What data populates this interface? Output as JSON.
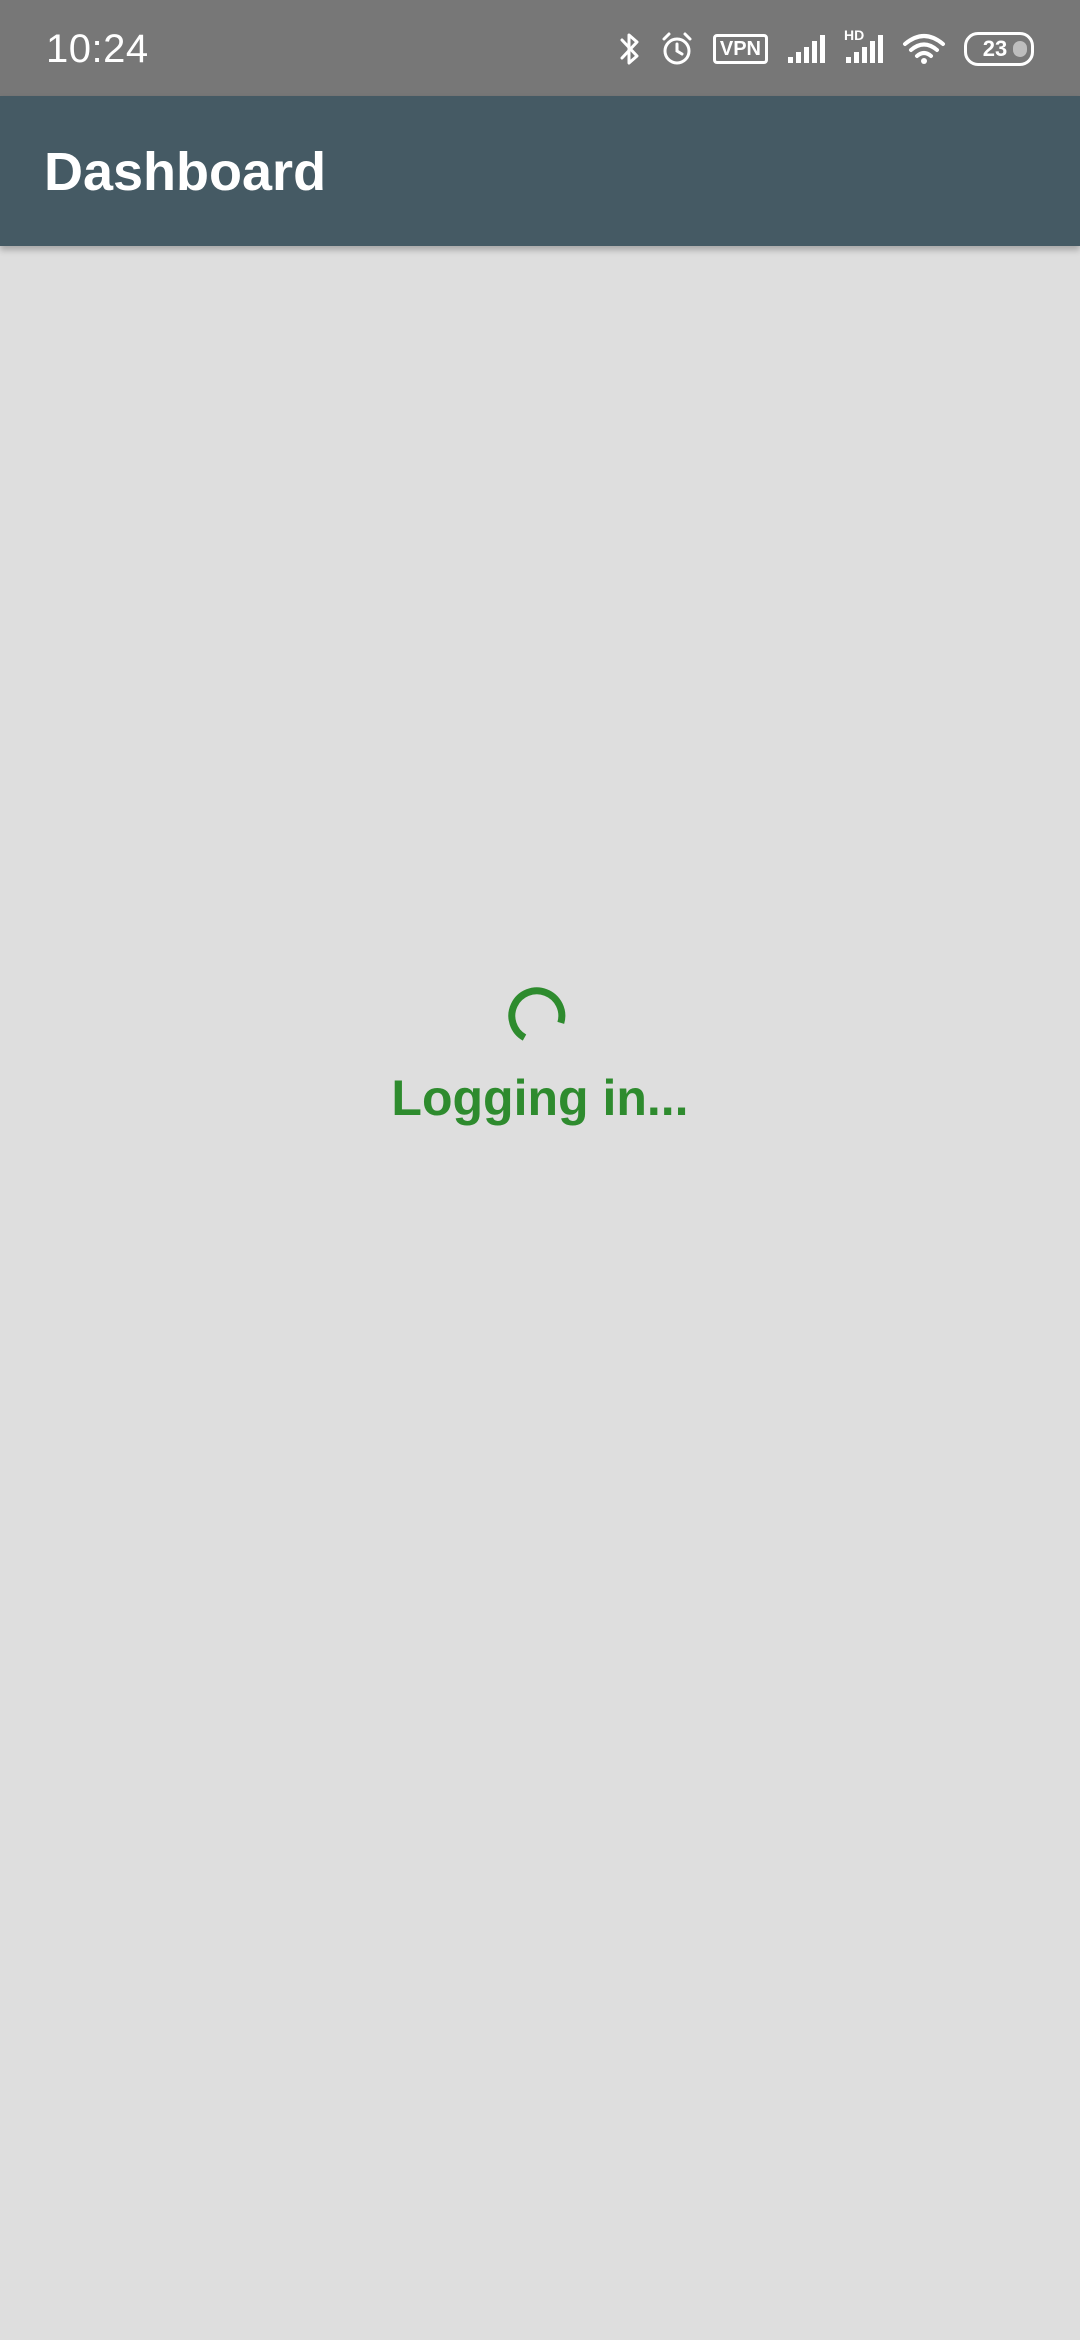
{
  "status_bar": {
    "time": "10:24",
    "vpn_label": "VPN",
    "network_label": "HD",
    "battery_level": "23",
    "icons": [
      "bluetooth-icon",
      "alarm-icon",
      "vpn-icon",
      "signal-icon",
      "hd-signal-icon",
      "wifi-icon",
      "battery-icon"
    ]
  },
  "app_bar": {
    "title": "Dashboard"
  },
  "loading": {
    "text": "Logging in...",
    "icon": "spinner-icon"
  },
  "colors": {
    "status_bar": "#777777",
    "app_bar": "#455a64",
    "background": "#dedede",
    "accent": "#2e8b2e"
  }
}
